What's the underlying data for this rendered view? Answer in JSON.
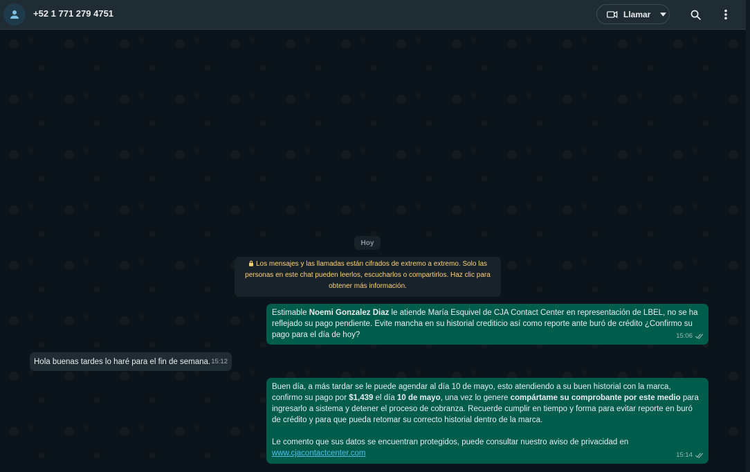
{
  "header": {
    "contact": "+52 1 771 279 4751",
    "call_label": "Llamar"
  },
  "chat": {
    "day_label": "Hoy",
    "encryption_notice": "Los mensajes y las llamadas están cifrados de extremo a extremo. Solo las personas en este chat pueden leerlos, escucharlos o compartirlos. Haz clic para obtener más información."
  },
  "messages": [
    {
      "direction": "out",
      "time": "15:06",
      "p1_a": "Estimable ",
      "p1_b": "Noemi Gonzalez Diaz",
      "p1_c": " le atiende María Esquivel de CJA Contact Center en representación de LBEL, no se ha reflejado su pago pendiente. Evite mancha en su historial crediticio así como reporte ante buró de crédito ¿Confirmo su pago para el día de hoy?"
    },
    {
      "direction": "in",
      "time": "15:12",
      "text": "Hola buenas tardes lo haré para el fin de semana."
    },
    {
      "direction": "out",
      "time": "15:14",
      "p1_a": "Buen día, a más tardar se le puede agendar al día 10 de mayo, esto atendiendo a su buen historial con la marca, confirmo su pago por ",
      "p1_b": "$1,439",
      "p1_c": " el día ",
      "p1_d": "10 de mayo",
      "p1_e": ", una vez lo genere ",
      "p1_f": "compártame su comprobante por este medio",
      "p1_g": " para ingresarlo a sistema y detener el proceso de cobranza. Recuerde cumplir en tiempo y forma para evitar reporte en buró de crédito y para que pueda retomar su correcto historial dentro de la marca.",
      "p2": "Le comento que sus datos se encuentran protegidos, puede consultar nuestro aviso de privacidad en",
      "link": "www.cjacontactcenter.com"
    }
  ]
}
